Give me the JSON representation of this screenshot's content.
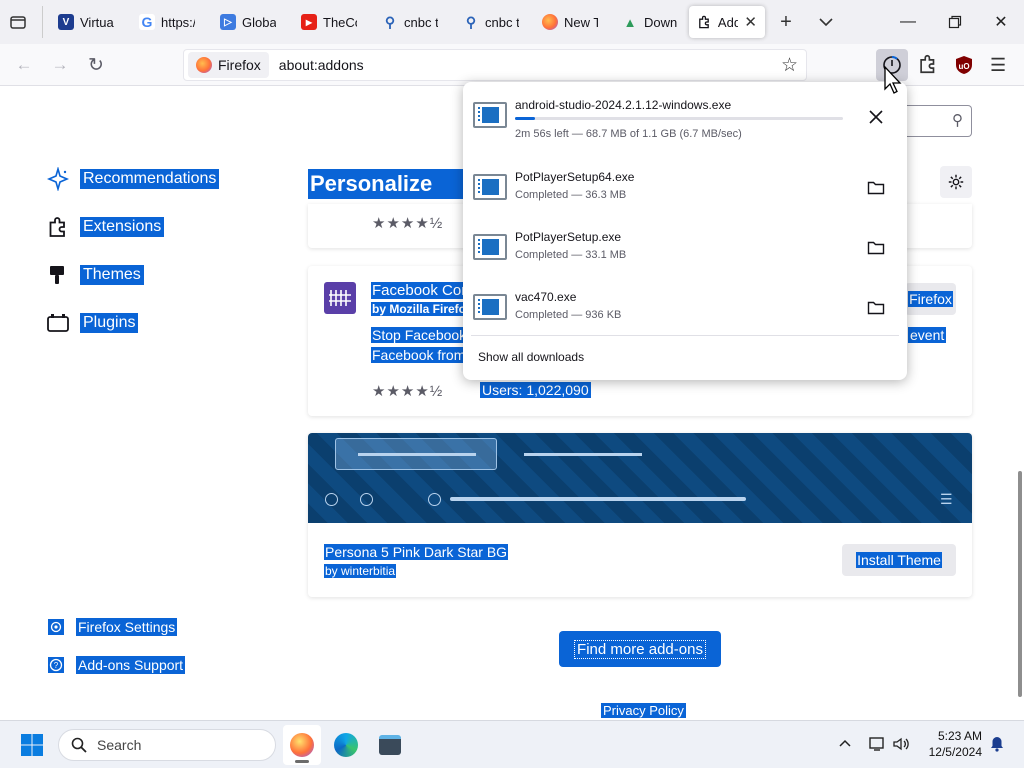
{
  "tabs": [
    {
      "label": "Virtual",
      "favicon": "virtualbox-icon",
      "color": "#1d3c8f",
      "glyph": "V"
    },
    {
      "label": "https:/",
      "favicon": "google-icon",
      "color": "#4285f4",
      "glyph": "G"
    },
    {
      "label": "Global",
      "favicon": "play-icon",
      "color": "#3d7be0",
      "glyph": "▷"
    },
    {
      "label": "TheCo",
      "favicon": "youtube-icon",
      "color": "#e62117",
      "glyph": "▶"
    },
    {
      "label": "cnbc t",
      "favicon": "search-icon",
      "color": "#2b63b8",
      "glyph": "⚲"
    },
    {
      "label": "cnbc t",
      "favicon": "search-icon",
      "color": "#2b63b8",
      "glyph": "⚲"
    },
    {
      "label": "New T",
      "favicon": "firefox-icon",
      "color": "#ff7139",
      "glyph": "●"
    },
    {
      "label": "Downl",
      "favicon": "android-icon",
      "color": "#2e9b5b",
      "glyph": "▲"
    },
    {
      "label": "Add",
      "favicon": "puzzle-icon",
      "color": "#15141a",
      "glyph": "◆"
    }
  ],
  "urlbar": {
    "identity": "Firefox",
    "url": "about:addons"
  },
  "sidebar": {
    "items": [
      {
        "label": "Recommendations",
        "icon": "sparkle-icon"
      },
      {
        "label": "Extensions",
        "icon": "puzzle-icon"
      },
      {
        "label": "Themes",
        "icon": "brush-icon"
      },
      {
        "label": "Plugins",
        "icon": "plugin-icon"
      }
    ],
    "footer": [
      {
        "label": "Firefox Settings",
        "icon": "gear-icon"
      },
      {
        "label": "Add-ons Support",
        "icon": "help-icon"
      }
    ]
  },
  "main": {
    "heading": "Personalize You",
    "card1": {
      "rating": "★★★★½"
    },
    "card2": {
      "title": "Facebook Con",
      "author": "by Mozilla Firefox",
      "desc_line1": "Stop Facebook",
      "desc_line2": "Facebook from",
      "desc_right": "event",
      "button": "Firefox",
      "rating": "★★★★½",
      "users": "Users: 1,022,090"
    },
    "theme_card": {
      "title": "Persona 5 Pink Dark Star BG",
      "author": "by winterbitia",
      "button": "Install Theme"
    },
    "find_more": "Find more add-ons",
    "privacy": "Privacy Policy"
  },
  "downloads": {
    "items": [
      {
        "name": "android-studio-2024.2.1.12-windows.exe",
        "status": "2m 56s left — 68.7 MB of 1.1 GB (6.7 MB/sec)",
        "progress": 0.06,
        "in_progress": true
      },
      {
        "name": "PotPlayerSetup64.exe",
        "status": "Completed — 36.3 MB",
        "in_progress": false
      },
      {
        "name": "PotPlayerSetup.exe",
        "status": "Completed — 33.1 MB",
        "in_progress": false
      },
      {
        "name": "vac470.exe",
        "status": "Completed — 936 KB",
        "in_progress": false
      }
    ],
    "show_all": "Show all downloads"
  },
  "taskbar": {
    "search_placeholder": "Search",
    "time": "5:23 AM",
    "date": "12/5/2024"
  },
  "colors": {
    "accent": "#0a64d6",
    "selection": "#0a64d6",
    "theme_banner": "#0b3f6e"
  }
}
